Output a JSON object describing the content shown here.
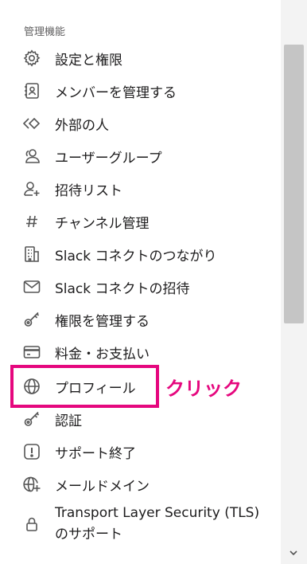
{
  "section_title": "管理機能",
  "items": [
    {
      "label": "設定と権限",
      "icon": "gear-icon"
    },
    {
      "label": "メンバーを管理する",
      "icon": "member-card-icon"
    },
    {
      "label": "外部の人",
      "icon": "external-diamond-icon"
    },
    {
      "label": "ユーザーグループ",
      "icon": "user-group-icon"
    },
    {
      "label": "招待リスト",
      "icon": "user-plus-icon"
    },
    {
      "label": "チャンネル管理",
      "icon": "hash-icon"
    },
    {
      "label": "Slack コネクトのつながり",
      "icon": "building-icon"
    },
    {
      "label": "Slack コネクトの招待",
      "icon": "envelope-icon"
    },
    {
      "label": "権限を管理する",
      "icon": "key-icon"
    },
    {
      "label": "料金・お支払い",
      "icon": "credit-card-icon"
    },
    {
      "label": "プロフィール",
      "icon": "globe-icon"
    },
    {
      "label": "認証",
      "icon": "key-icon"
    },
    {
      "label": "サポート終了",
      "icon": "exclamation-icon"
    },
    {
      "label": "メールドメイン",
      "icon": "globe-plus-icon"
    },
    {
      "label": "Transport Layer Security (TLS) のサポート",
      "icon": "lock-icon"
    }
  ],
  "annotation": {
    "text": "クリック",
    "color": "#e5077e"
  }
}
